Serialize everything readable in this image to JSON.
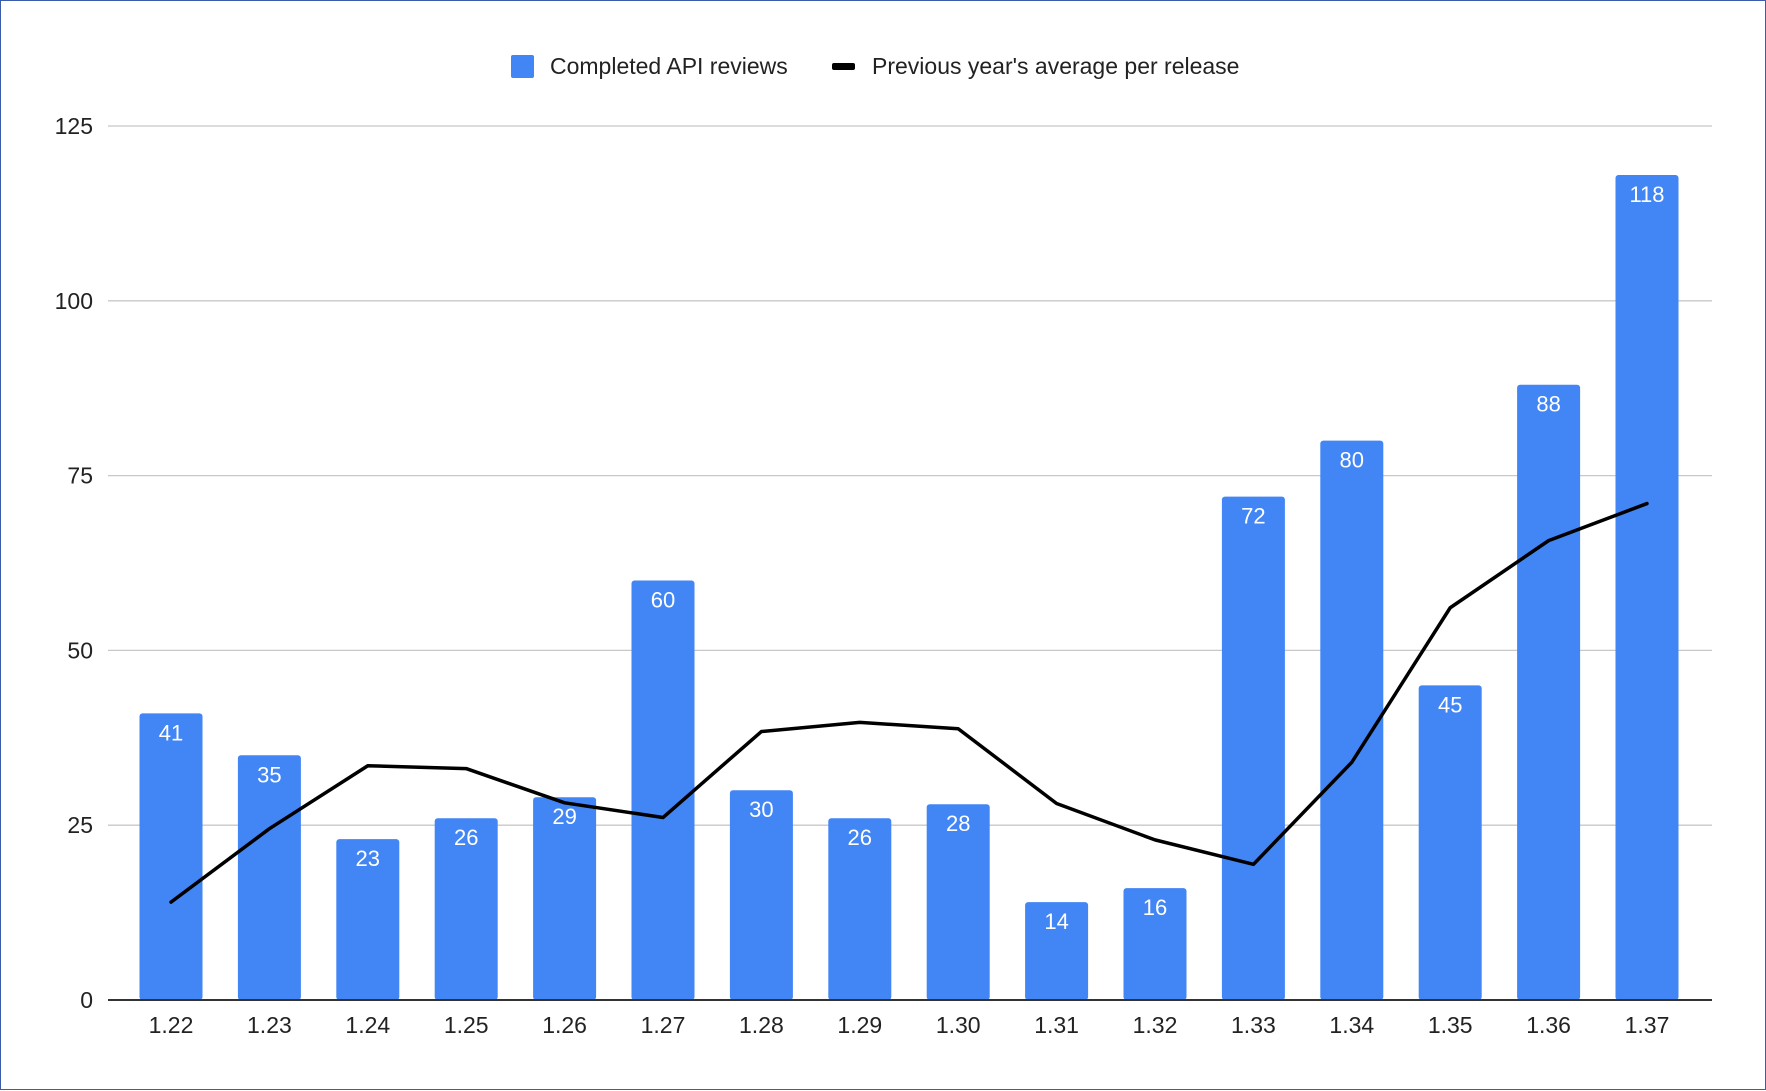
{
  "chart_data": {
    "type": "bar",
    "categories": [
      "1.22",
      "1.23",
      "1.24",
      "1.25",
      "1.26",
      "1.27",
      "1.28",
      "1.29",
      "1.30",
      "1.31",
      "1.32",
      "1.33",
      "1.34",
      "1.35",
      "1.36",
      "1.37"
    ],
    "series": [
      {
        "name": "Completed API reviews",
        "type": "bar",
        "color": "#4285f4",
        "values": [
          41,
          35,
          23,
          26,
          29,
          60,
          30,
          26,
          28,
          14,
          16,
          72,
          80,
          45,
          88,
          118
        ],
        "data_labels": [
          "41",
          "35",
          "23",
          "26",
          "29",
          "60",
          "30",
          "26",
          "28",
          "14",
          "16",
          "72",
          "80",
          "45",
          "88",
          "118"
        ]
      },
      {
        "name": "Previous year's average per release",
        "type": "line",
        "color": "#000000",
        "values": [
          14.0,
          24.5,
          33.5,
          33.1,
          28.2,
          26.1,
          38.4,
          39.7,
          38.8,
          28.1,
          22.9,
          19.4,
          34.0,
          56.1,
          65.7,
          71.0
        ]
      }
    ],
    "ylim": [
      0,
      125
    ],
    "yticks": [
      "0",
      "25",
      "50",
      "75",
      "100",
      "125"
    ],
    "ytick_values": [
      0,
      25,
      50,
      75,
      100,
      125
    ],
    "grid": true,
    "legend_position": "top-center",
    "title": "",
    "xlabel": "",
    "ylabel": ""
  }
}
